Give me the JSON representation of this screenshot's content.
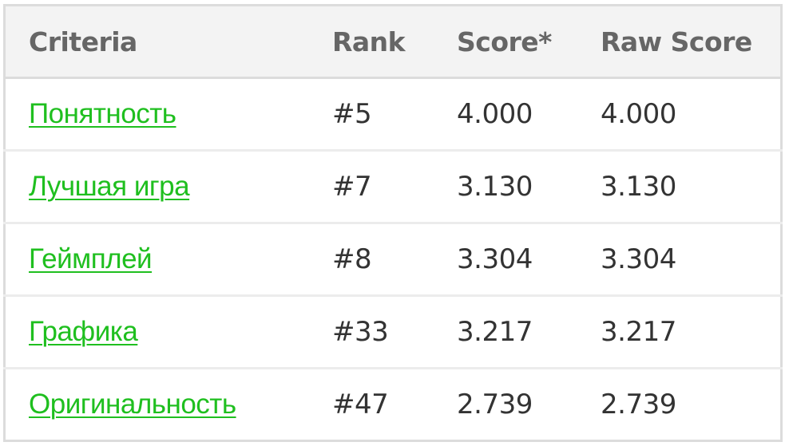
{
  "table": {
    "headers": {
      "criteria": "Criteria",
      "rank": "Rank",
      "score": "Score*",
      "raw_score": "Raw Score"
    },
    "rows": [
      {
        "criteria": "Понятность",
        "rank": "#5",
        "score": "4.000",
        "raw_score": "4.000"
      },
      {
        "criteria": "Лучшая игра",
        "rank": "#7",
        "score": "3.130",
        "raw_score": "3.130"
      },
      {
        "criteria": "Геймплей",
        "rank": "#8",
        "score": "3.304",
        "raw_score": "3.304"
      },
      {
        "criteria": "Графика",
        "rank": "#33",
        "score": "3.217",
        "raw_score": "3.217"
      },
      {
        "criteria": "Оригинальность",
        "rank": "#47",
        "score": "2.739",
        "raw_score": "2.739"
      }
    ],
    "colors": {
      "link": "#1fbf1f",
      "header_bg": "#f3f3f3",
      "header_text": "#666666",
      "cell_text": "#333333"
    }
  }
}
